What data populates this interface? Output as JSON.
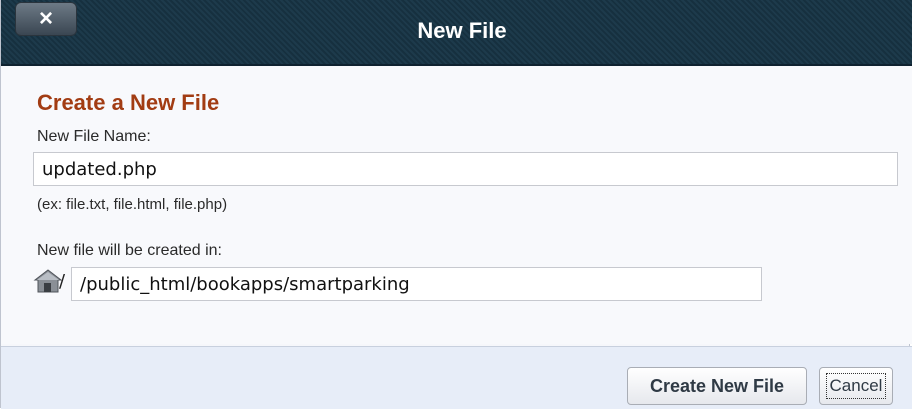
{
  "window": {
    "title": "New File",
    "close_glyph": "×"
  },
  "form": {
    "heading": "Create a New File",
    "file_name_label": "New File Name:",
    "file_name_value": "updated.php",
    "hint": "(ex: file.txt, file.html, file.php)",
    "location_label": "New file will be created in:",
    "location_prefix": "/",
    "location_value": "/public_html/bookapps/smartparking"
  },
  "buttons": {
    "create_label": "Create New File",
    "cancel_label": "Cancel"
  },
  "icons": {
    "close": "close-icon",
    "home": "home-icon"
  },
  "colors": {
    "titlebar": "#1a3545",
    "heading": "#a23c13",
    "footer": "#e7edf8"
  }
}
